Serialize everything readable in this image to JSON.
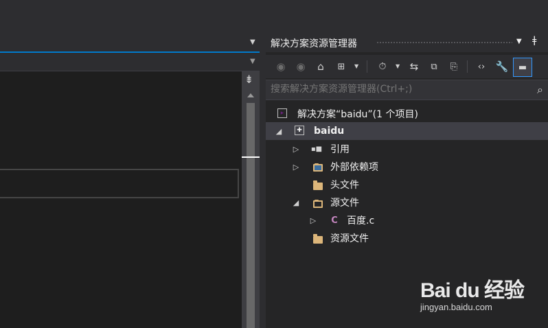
{
  "solution_explorer": {
    "title": "解决方案资源管理器",
    "search_placeholder": "搜索解决方案资源管理器(Ctrl+;)",
    "tree": {
      "solution_label": "解决方案“baidu”(1 个项目)",
      "project_label": "baidu",
      "references_label": "引用",
      "external_deps_label": "外部依赖项",
      "header_files_label": "头文件",
      "source_files_label": "源文件",
      "source_file_label": "百度.c",
      "resource_files_label": "资源文件"
    },
    "icons": {
      "dropdown": "chevron-down-icon",
      "pin": "pin-icon",
      "back": "back-icon",
      "forward": "forward-icon",
      "home": "home-icon",
      "switch_views": "switch-views-icon",
      "pending_changes": "pending-changes-icon",
      "sync": "sync-icon",
      "collapse_all": "collapse-all-icon",
      "show_all_files": "show-all-files-icon",
      "view_code": "view-code-icon",
      "properties": "wrench-icon",
      "preview": "preview-icon",
      "search": "search-icon"
    }
  },
  "watermark": {
    "logo_text": "Bai du 经验",
    "url_text": "jingyan.baidu.com"
  },
  "colors": {
    "accent": "#007acc",
    "background": "#2d2d30",
    "panel": "#252526",
    "selected_row": "#3f3f46",
    "folder": "#dcb67a",
    "c_file": "#c586c0"
  }
}
